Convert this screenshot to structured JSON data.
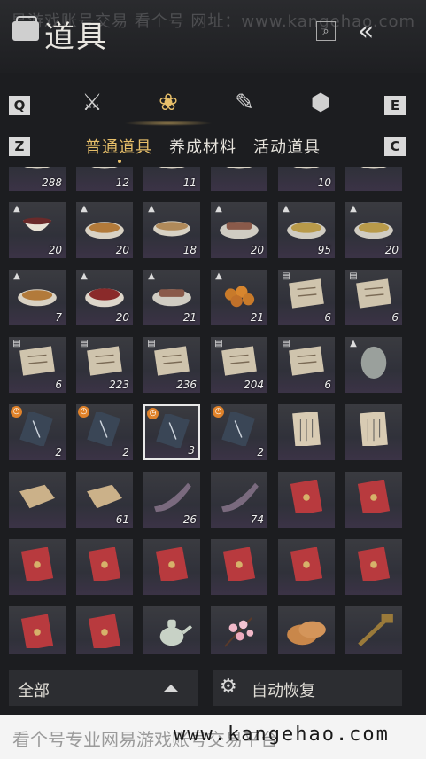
{
  "header": {
    "watermark": "易游戏账号交易 看个号   网址：www.kangehao.com",
    "title": "道具",
    "search_icon": "search-icon",
    "back_icon": "double-chevron-left-icon"
  },
  "category_tabs": {
    "left_key": "Q",
    "right_key": "E",
    "items": [
      {
        "icon": "crossed-swords-icon",
        "glyph": "⚔"
      },
      {
        "icon": "pouch-icon",
        "glyph": "♉",
        "active": true
      },
      {
        "icon": "scroll-icon",
        "glyph": "✎"
      },
      {
        "icon": "gem-icon",
        "glyph": "⬢"
      }
    ],
    "accent": "#e8c06a"
  },
  "sub_tabs": {
    "left_key": "Z",
    "right_key": "C",
    "items": [
      "普通道具",
      "养成材料",
      "活动道具"
    ],
    "active_index": 0
  },
  "inventory": {
    "rows": [
      [
        {
          "qty": "288",
          "art": "bowl"
        },
        {
          "qty": "12",
          "art": "bowl"
        },
        {
          "qty": "11",
          "art": "bowl"
        },
        {
          "qty": "",
          "art": "bowl"
        },
        {
          "qty": "10",
          "art": "bowl"
        },
        {
          "qty": "",
          "art": "bowl"
        }
      ],
      [
        {
          "qty": "20",
          "art": "tea",
          "mark": "tri"
        },
        {
          "qty": "20",
          "art": "food",
          "mark": "tri"
        },
        {
          "qty": "18",
          "art": "bowl",
          "mark": "tri"
        },
        {
          "qty": "20",
          "art": "meat",
          "mark": "tri"
        },
        {
          "qty": "95",
          "art": "noodle",
          "mark": "tri"
        },
        {
          "qty": "20",
          "art": "noodle",
          "mark": "tri"
        }
      ],
      [
        {
          "qty": "7",
          "art": "food",
          "mark": "tri"
        },
        {
          "qty": "20",
          "art": "berry",
          "mark": "tri"
        },
        {
          "qty": "21",
          "art": "meat",
          "mark": "tri"
        },
        {
          "qty": "21",
          "art": "balls",
          "mark": "tri"
        },
        {
          "qty": "6",
          "art": "paper",
          "mark": "doc"
        },
        {
          "qty": "6",
          "art": "paper",
          "mark": "doc"
        }
      ],
      [
        {
          "qty": "6",
          "art": "paper",
          "mark": "doc"
        },
        {
          "qty": "223",
          "art": "paper",
          "mark": "doc"
        },
        {
          "qty": "236",
          "art": "paper",
          "mark": "doc"
        },
        {
          "qty": "204",
          "art": "paper",
          "mark": "doc"
        },
        {
          "qty": "6",
          "art": "paper",
          "mark": "doc"
        },
        {
          "qty": "",
          "art": "egg",
          "mark": "tri"
        }
      ],
      [
        {
          "qty": "2",
          "art": "ticket",
          "mark": "clock"
        },
        {
          "qty": "2",
          "art": "ticket",
          "mark": "clock"
        },
        {
          "qty": "3",
          "art": "ticket",
          "mark": "clock",
          "selected": true
        },
        {
          "qty": "2",
          "art": "ticket",
          "mark": "clock"
        },
        {
          "qty": "",
          "art": "letter"
        },
        {
          "qty": "",
          "art": "letter"
        }
      ],
      [
        {
          "qty": "",
          "art": "cloth"
        },
        {
          "qty": "61",
          "art": "cloth"
        },
        {
          "qty": "26",
          "art": "horn"
        },
        {
          "qty": "74",
          "art": "horn"
        },
        {
          "qty": "",
          "art": "envelope"
        },
        {
          "qty": "",
          "art": "envelope"
        }
      ],
      [
        {
          "qty": "",
          "art": "envelope"
        },
        {
          "qty": "",
          "art": "envelope"
        },
        {
          "qty": "",
          "art": "envelope"
        },
        {
          "qty": "",
          "art": "envelope"
        },
        {
          "qty": "",
          "art": "envelope"
        },
        {
          "qty": "",
          "art": "envelope"
        }
      ],
      [
        {
          "qty": "",
          "art": "envelope"
        },
        {
          "qty": "",
          "art": "envelope"
        },
        {
          "qty": "",
          "art": "teapot"
        },
        {
          "qty": "",
          "art": "blossom"
        },
        {
          "qty": "",
          "art": "cake"
        },
        {
          "qty": "",
          "art": "key"
        }
      ]
    ]
  },
  "bottom": {
    "filter_label": "全部",
    "auto_label": "自动恢复",
    "auto_icon": "gear-icon"
  },
  "footer": {
    "watermark_text": "看个号专业网易游戏账号交易平台",
    "url": "www.kangehao.com"
  }
}
